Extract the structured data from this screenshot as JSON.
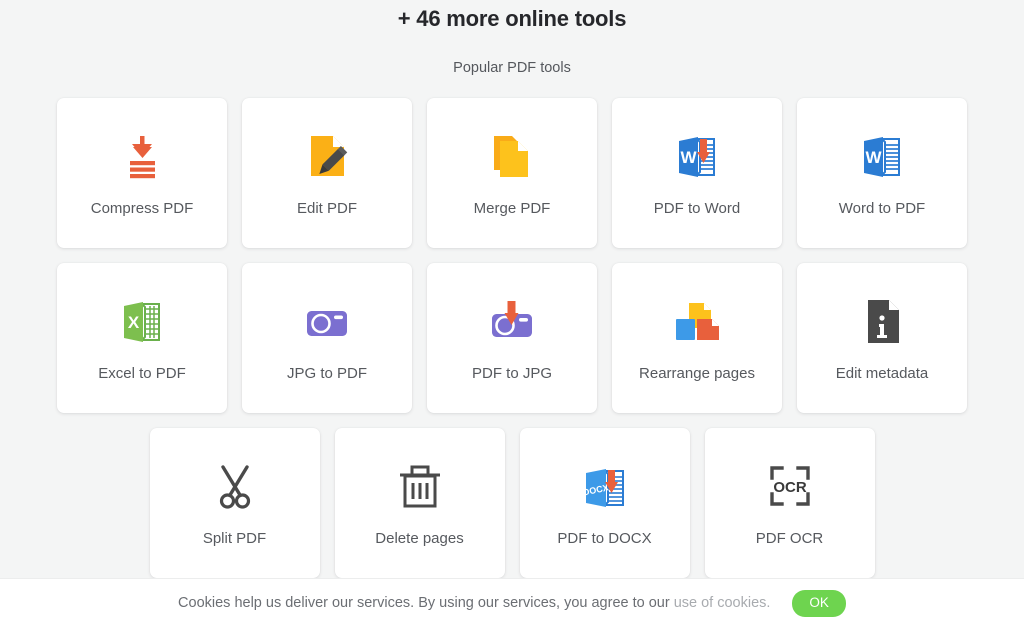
{
  "header": {
    "title": "+ 46 more online tools",
    "subtitle": "Popular PDF tools"
  },
  "colors": {
    "page_background": "#f4f5f5",
    "card_background": "#ffffff",
    "label_text": "#56595e",
    "heading_text": "#26272b",
    "accent_red": "#e8603c",
    "accent_orange": "#fbb016",
    "accent_yellow": "#fdc21c",
    "accent_blue": "#2b7cd3",
    "accent_green": "#6ab04c",
    "accent_purple": "#7b6fd0",
    "accent_gray": "#4a4a4a",
    "ok_button_green": "#6ed44f",
    "cookie_link_gray": "#a8abaf"
  },
  "rows": [
    {
      "tools": [
        {
          "label": "Compress PDF",
          "icon": "compress-arrow-icon"
        },
        {
          "label": "Edit PDF",
          "icon": "document-pencil-icon"
        },
        {
          "label": "Merge PDF",
          "icon": "two-documents-icon"
        },
        {
          "label": "PDF to Word",
          "icon": "word-download-icon"
        },
        {
          "label": "Word to PDF",
          "icon": "word-document-icon"
        }
      ]
    },
    {
      "tools": [
        {
          "label": "Excel to PDF",
          "icon": "excel-document-icon"
        },
        {
          "label": "JPG to PDF",
          "icon": "camera-icon"
        },
        {
          "label": "PDF to JPG",
          "icon": "camera-download-icon"
        },
        {
          "label": "Rearrange pages",
          "icon": "three-pages-icon"
        },
        {
          "label": "Edit metadata",
          "icon": "document-info-icon"
        }
      ]
    },
    {
      "tools": [
        {
          "label": "Split PDF",
          "icon": "scissors-icon"
        },
        {
          "label": "Delete pages",
          "icon": "trash-icon"
        },
        {
          "label": "PDF to DOCX",
          "icon": "docx-download-icon"
        },
        {
          "label": "PDF OCR",
          "icon": "ocr-frame-icon"
        }
      ]
    }
  ],
  "cookie_banner": {
    "message": "Cookies help us deliver our services. By using our services, you agree to our",
    "link_label": "use of cookies.",
    "ok_label": "OK"
  }
}
